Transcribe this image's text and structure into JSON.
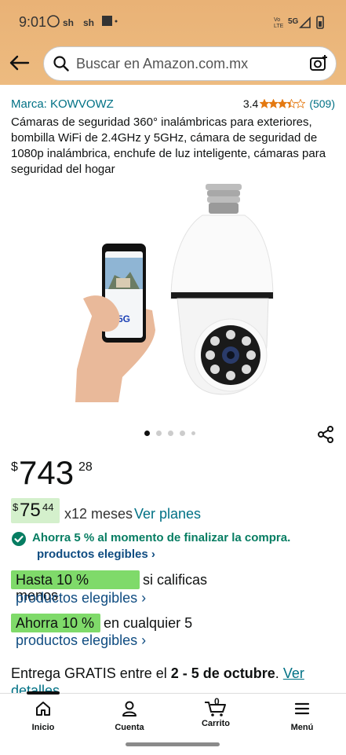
{
  "status_bar": {
    "time": "9:01",
    "left_icons": "ⓦ  sh  sh  ■  •",
    "right_text": "5G"
  },
  "search": {
    "placeholder": "Buscar en Amazon.com.mx"
  },
  "product": {
    "brand": "Marca: KOWVOWZ",
    "rating_value": "3.4",
    "rating_stars": 3.4,
    "rating_count": "(509)",
    "title": "Cámaras de seguridad 360° inalámbricas para exteriores, bombilla WiFi de 2.4GHz y 5GHz, cámara de seguridad de 1080p inalámbrica, enchufe de luz inteligente, cámaras para seguridad del hogar",
    "image_phone_badge": "5G",
    "carousel_total": 5,
    "carousel_active": 1
  },
  "price": {
    "currency": "$",
    "whole": "743",
    "cents": "28"
  },
  "monthly": {
    "currency": "$",
    "whole": "75",
    "cents": "44",
    "term": "x12 meses",
    "link": "Ver planes"
  },
  "promos": {
    "checkout_savings": "Ahorra 5 % al momento de finalizar la compra.",
    "eligible_1": "productos elegibles ›",
    "highlight_1": "Hasta 10 % menos",
    "after_1": "si calificas",
    "eligible_2": "productos elegibles ›",
    "highlight_2": "Ahorra 10 %",
    "after_2": "en cualquier 5",
    "eligible_3": "productos elegibles ›"
  },
  "delivery": {
    "prefix": "Entrega GRATIS entre el ",
    "dates": "2 - 5 de octubre",
    "suffix": ". ",
    "link": "Ver",
    "link2": "detalles"
  },
  "bottom_nav": {
    "items": [
      {
        "label": "Inicio"
      },
      {
        "label": "Cuenta"
      },
      {
        "label": "Carrito",
        "badge": "0"
      },
      {
        "label": "Menú"
      }
    ]
  },
  "colors": {
    "header": "#e9b276",
    "link": "#007185",
    "green_highlight": "#7fda6a",
    "savings_green": "#067d62",
    "star": "#e47911"
  }
}
